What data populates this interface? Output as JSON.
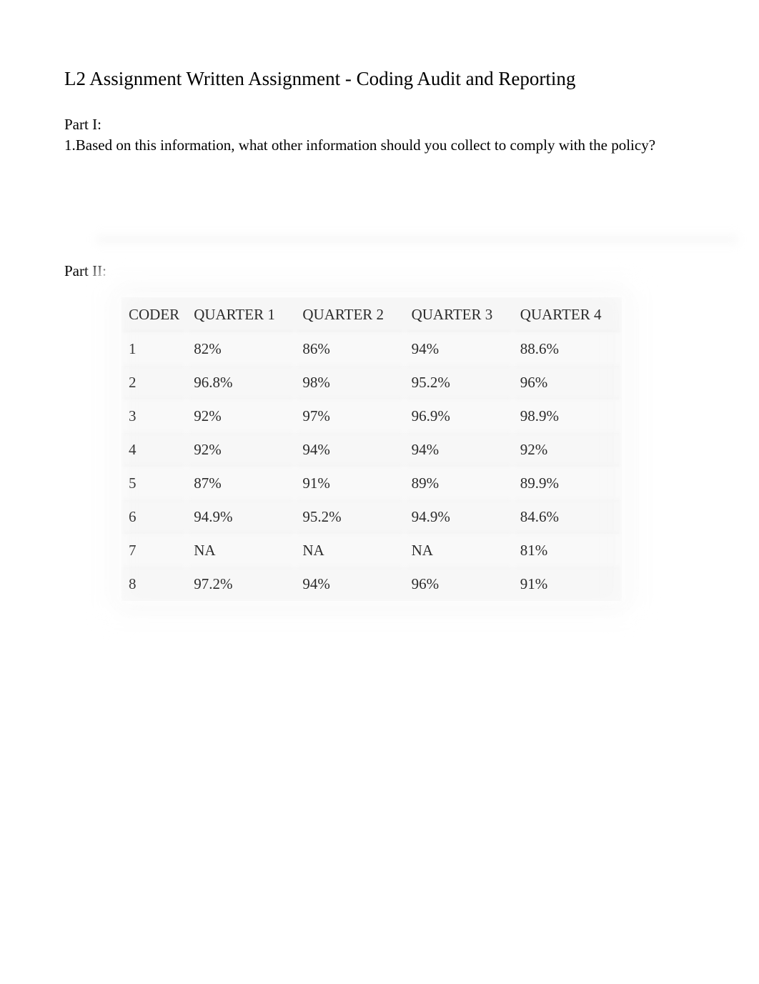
{
  "title": "L2 Assignment Written Assignment - Coding Audit and Reporting",
  "part1": {
    "label": "Part I:",
    "question": "1.Based on this information, what other information should you collect to comply with the policy?"
  },
  "part2": {
    "label": "Part II:"
  },
  "chart_data": {
    "type": "table",
    "title": "",
    "columns": [
      "CODER",
      "QUARTER 1",
      "QUARTER 2",
      "QUARTER 3",
      "QUARTER 4"
    ],
    "rows": [
      [
        "1",
        "82%",
        "86%",
        "94%",
        "88.6%"
      ],
      [
        "2",
        "96.8%",
        "98%",
        "95.2%",
        "96%"
      ],
      [
        "3",
        "92%",
        "97%",
        "96.9%",
        "98.9%"
      ],
      [
        "4",
        "92%",
        "94%",
        "94%",
        "92%"
      ],
      [
        "5",
        "87%",
        "91%",
        "89%",
        "89.9%"
      ],
      [
        "6",
        "94.9%",
        "95.2%",
        "94.9%",
        "84.6%"
      ],
      [
        "7",
        "NA",
        "NA",
        "NA",
        "81%"
      ],
      [
        "8",
        "97.2%",
        "94%",
        "96%",
        "91%"
      ]
    ]
  }
}
